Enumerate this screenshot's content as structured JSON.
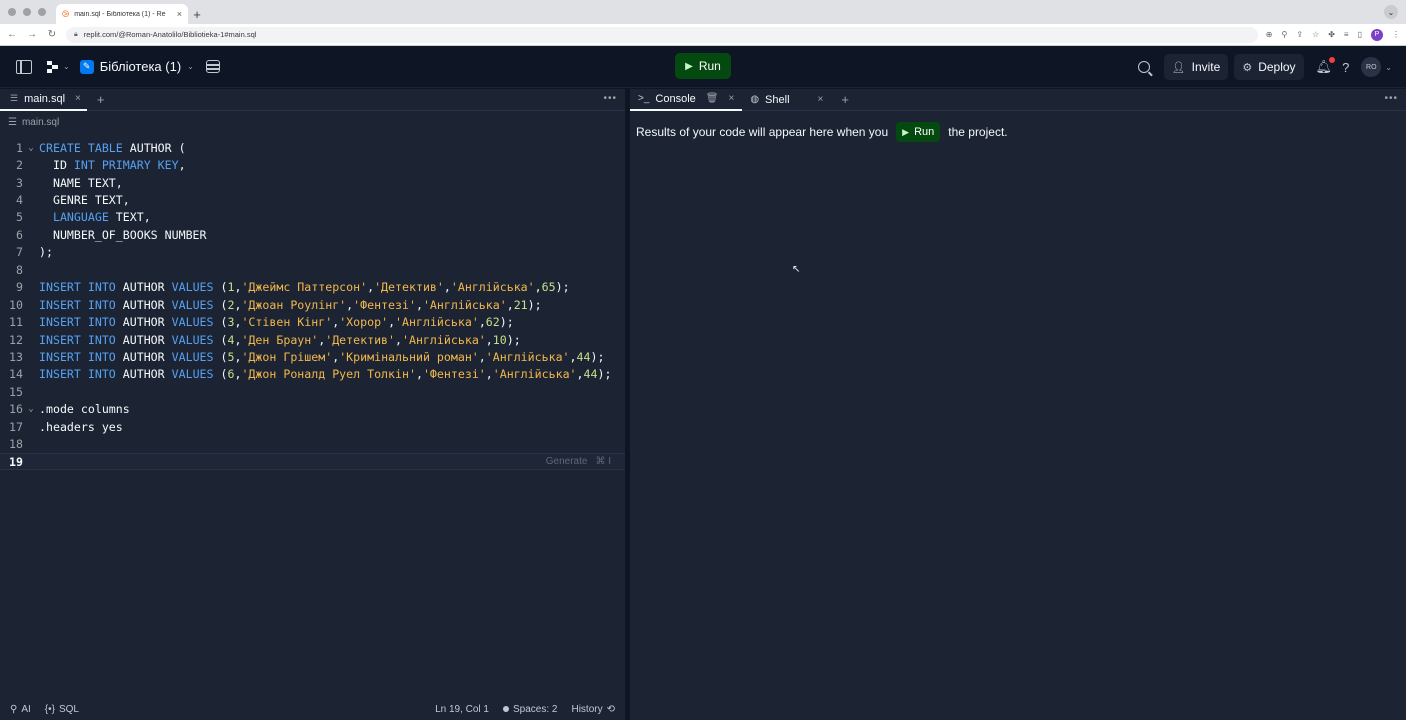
{
  "browser": {
    "tab_title": "main.sql - Бібліотека (1) - Re",
    "url": "replit.com/@Roman-Anatolilo/Bibliotieka-1#main.sql",
    "profile_initial": "P"
  },
  "header": {
    "project_name": "Бібліотека (1)",
    "run_label": "Run",
    "invite_label": "Invite",
    "deploy_label": "Deploy",
    "avatar_initials": "RO"
  },
  "editor": {
    "tab_label": "main.sql",
    "breadcrumb": "main.sql",
    "generate_hint": "Generate",
    "generate_shortcut": "⌘ I",
    "lines": [
      {
        "n": "1",
        "fold": "⌄",
        "tokens": [
          [
            "kw",
            "CREATE TABLE"
          ],
          [
            "id",
            " AUTHOR ("
          ]
        ]
      },
      {
        "n": "2",
        "fold": "",
        "tokens": [
          [
            "id",
            "  ID "
          ],
          [
            "kw",
            "INT PRIMARY KEY"
          ],
          [
            "id",
            ","
          ]
        ]
      },
      {
        "n": "3",
        "fold": "",
        "tokens": [
          [
            "id",
            "  NAME TEXT,"
          ]
        ]
      },
      {
        "n": "4",
        "fold": "",
        "tokens": [
          [
            "id",
            "  GENRE TEXT,"
          ]
        ]
      },
      {
        "n": "5",
        "fold": "",
        "tokens": [
          [
            "kw",
            "  LANGUAGE"
          ],
          [
            "id",
            " TEXT,"
          ]
        ]
      },
      {
        "n": "6",
        "fold": "",
        "tokens": [
          [
            "id",
            "  NUMBER_OF_BOOKS NUMBER"
          ]
        ]
      },
      {
        "n": "7",
        "fold": "",
        "tokens": [
          [
            "id",
            ");"
          ]
        ]
      },
      {
        "n": "8",
        "fold": "",
        "tokens": []
      },
      {
        "n": "9",
        "fold": "",
        "tokens": [
          [
            "kw",
            "INSERT INTO"
          ],
          [
            "id",
            " AUTHOR "
          ],
          [
            "kw",
            "VALUES"
          ],
          [
            "id",
            " ("
          ],
          [
            "num",
            "1"
          ],
          [
            "id",
            ","
          ],
          [
            "str",
            "'Джеймс Паттерсон'"
          ],
          [
            "id",
            ","
          ],
          [
            "str",
            "'Детектив'"
          ],
          [
            "id",
            ","
          ],
          [
            "str",
            "'Англійська'"
          ],
          [
            "id",
            ","
          ],
          [
            "num",
            "65"
          ],
          [
            "id",
            ");"
          ]
        ]
      },
      {
        "n": "10",
        "fold": "",
        "tokens": [
          [
            "kw",
            "INSERT INTO"
          ],
          [
            "id",
            " AUTHOR "
          ],
          [
            "kw",
            "VALUES"
          ],
          [
            "id",
            " ("
          ],
          [
            "num",
            "2"
          ],
          [
            "id",
            ","
          ],
          [
            "str",
            "'Джоан Роулінг'"
          ],
          [
            "id",
            ","
          ],
          [
            "str",
            "'Фентезі'"
          ],
          [
            "id",
            ","
          ],
          [
            "str",
            "'Англійська'"
          ],
          [
            "id",
            ","
          ],
          [
            "num",
            "21"
          ],
          [
            "id",
            ");"
          ]
        ]
      },
      {
        "n": "11",
        "fold": "",
        "tokens": [
          [
            "kw",
            "INSERT INTO"
          ],
          [
            "id",
            " AUTHOR "
          ],
          [
            "kw",
            "VALUES"
          ],
          [
            "id",
            " ("
          ],
          [
            "num",
            "3"
          ],
          [
            "id",
            ","
          ],
          [
            "str",
            "'Стівен Кінг'"
          ],
          [
            "id",
            ","
          ],
          [
            "str",
            "'Хорор'"
          ],
          [
            "id",
            ","
          ],
          [
            "str",
            "'Англійська'"
          ],
          [
            "id",
            ","
          ],
          [
            "num",
            "62"
          ],
          [
            "id",
            ");"
          ]
        ]
      },
      {
        "n": "12",
        "fold": "",
        "tokens": [
          [
            "kw",
            "INSERT INTO"
          ],
          [
            "id",
            " AUTHOR "
          ],
          [
            "kw",
            "VALUES"
          ],
          [
            "id",
            " ("
          ],
          [
            "num",
            "4"
          ],
          [
            "id",
            ","
          ],
          [
            "str",
            "'Ден Браун'"
          ],
          [
            "id",
            ","
          ],
          [
            "str",
            "'Детектив'"
          ],
          [
            "id",
            ","
          ],
          [
            "str",
            "'Англійська'"
          ],
          [
            "id",
            ","
          ],
          [
            "num",
            "10"
          ],
          [
            "id",
            ");"
          ]
        ]
      },
      {
        "n": "13",
        "fold": "",
        "tokens": [
          [
            "kw",
            "INSERT INTO"
          ],
          [
            "id",
            " AUTHOR "
          ],
          [
            "kw",
            "VALUES"
          ],
          [
            "id",
            " ("
          ],
          [
            "num",
            "5"
          ],
          [
            "id",
            ","
          ],
          [
            "str",
            "'Джон Грішем'"
          ],
          [
            "id",
            ","
          ],
          [
            "str",
            "'Кримінальний роман'"
          ],
          [
            "id",
            ","
          ],
          [
            "str",
            "'Англійська'"
          ],
          [
            "id",
            ","
          ],
          [
            "num",
            "44"
          ],
          [
            "id",
            ");"
          ]
        ]
      },
      {
        "n": "14",
        "fold": "",
        "tokens": [
          [
            "kw",
            "INSERT INTO"
          ],
          [
            "id",
            " AUTHOR "
          ],
          [
            "kw",
            "VALUES"
          ],
          [
            "id",
            " ("
          ],
          [
            "num",
            "6"
          ],
          [
            "id",
            ","
          ],
          [
            "str",
            "'Джон Роналд Руел Толкін'"
          ],
          [
            "id",
            ","
          ],
          [
            "str",
            "'Фентезі'"
          ],
          [
            "id",
            ","
          ],
          [
            "str",
            "'Англійська'"
          ],
          [
            "id",
            ","
          ],
          [
            "num",
            "44"
          ],
          [
            "id",
            ");"
          ]
        ]
      },
      {
        "n": "15",
        "fold": "",
        "tokens": []
      },
      {
        "n": "16",
        "fold": "⌄",
        "tokens": [
          [
            "id",
            ".mode columns"
          ]
        ]
      },
      {
        "n": "17",
        "fold": "",
        "tokens": [
          [
            "id",
            ".headers yes"
          ]
        ]
      },
      {
        "n": "18",
        "fold": "",
        "tokens": []
      },
      {
        "n": "19",
        "fold": "",
        "tokens": [],
        "active": true
      }
    ]
  },
  "statusbar": {
    "ai_label": "AI",
    "lang_label": "SQL",
    "lang_icon": "{•}",
    "position": "Ln 19, Col 1",
    "spaces": "Spaces: 2",
    "history": "History"
  },
  "console": {
    "console_tab": "Console",
    "shell_tab": "Shell",
    "msg_before": "Results of your code will appear here when you",
    "run_label": "Run",
    "msg_after": "the project."
  },
  "colors": {
    "bg": "#0e1525",
    "panel": "#1c2333",
    "run_green": "#044a10",
    "keyword": "#56a1f0",
    "string": "#f2b84b",
    "number": "#c4e08a"
  }
}
